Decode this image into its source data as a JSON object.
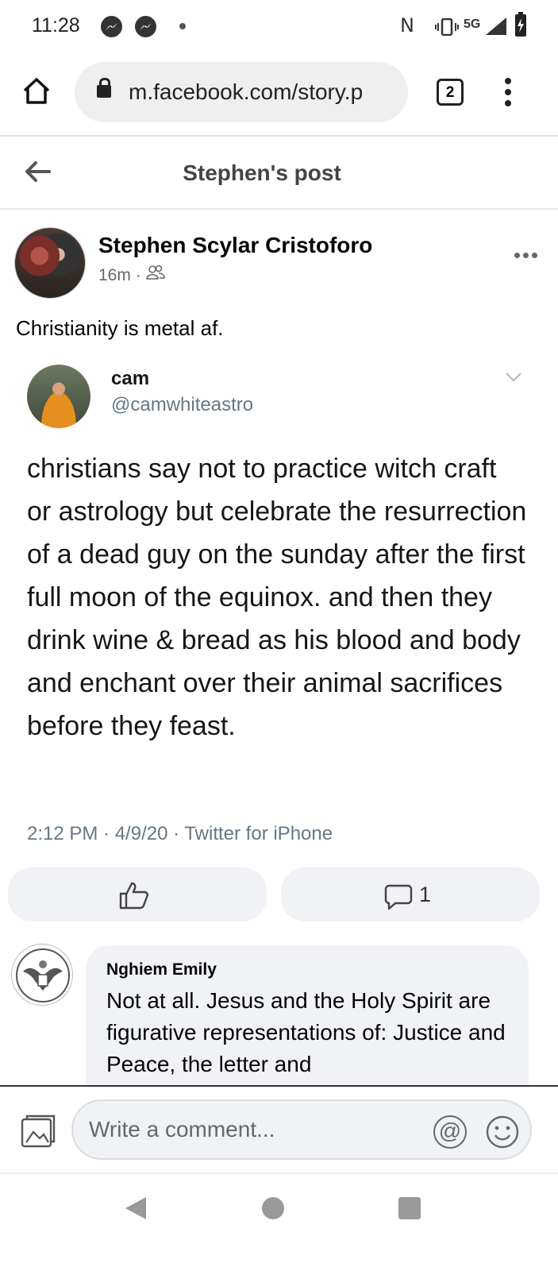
{
  "status_bar": {
    "time": "11:28",
    "network": "5G",
    "icons": [
      "messenger-icon",
      "messenger-icon",
      "notification-dot",
      "nfc-icon",
      "vibrate-icon",
      "signal-icon",
      "battery-charging-icon"
    ]
  },
  "browser": {
    "url": "m.facebook.com/story.p",
    "tab_count": "2"
  },
  "header": {
    "title": "Stephen's post"
  },
  "post": {
    "author": "Stephen Scylar Cristoforo",
    "time": "16m",
    "separator": "·",
    "audience_icon": "friends-icon",
    "text": "Christianity is metal af."
  },
  "tweet": {
    "name": "cam",
    "handle": "@camwhiteastro",
    "text": "christians say not to practice witch craft or astrology but celebrate the resurrection of a dead guy on the sunday after the first full moon of the equinox. and then they drink wine & bread as his blood and body and enchant over their animal sacrifices before they feast.",
    "meta": "2:12 PM · 4/9/20 · Twitter for iPhone"
  },
  "actions": {
    "comment_count": "1"
  },
  "comment": {
    "name": "Nghiem Emily",
    "text": "Not at all. Jesus and the Holy Spirit are figurative representations of: Justice and Peace, the letter and"
  },
  "composer": {
    "placeholder": "Write a comment...",
    "at_symbol": "@"
  }
}
